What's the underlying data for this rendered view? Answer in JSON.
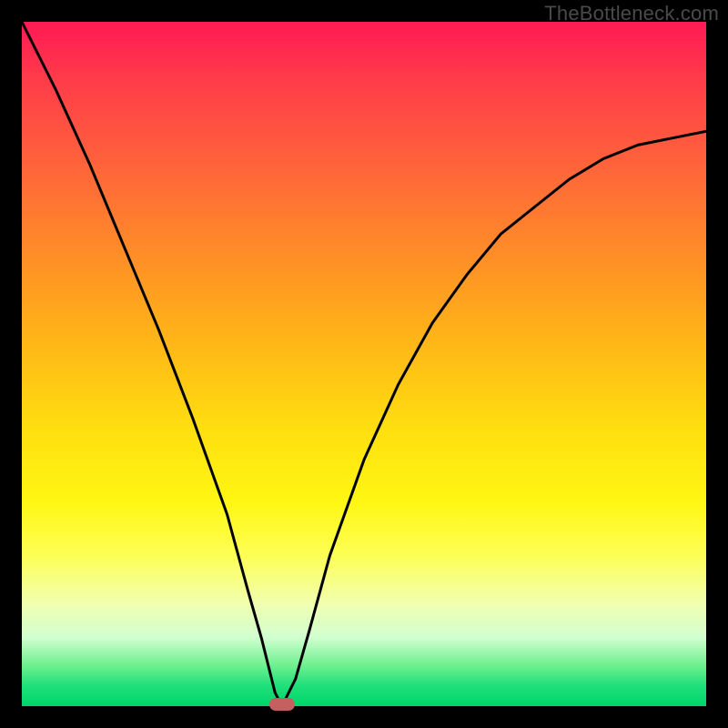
{
  "watermark": "TheBottleneck.com",
  "chart_data": {
    "type": "line",
    "title": "",
    "xlabel": "",
    "ylabel": "",
    "xlim": [
      0,
      100
    ],
    "ylim": [
      0,
      100
    ],
    "grid": false,
    "series": [
      {
        "name": "bottleneck-curve",
        "x": [
          0,
          5,
          10,
          15,
          20,
          25,
          30,
          33,
          35,
          36,
          37,
          38,
          40,
          42,
          45,
          50,
          55,
          60,
          65,
          70,
          75,
          80,
          85,
          90,
          95,
          100
        ],
        "values": [
          100,
          90,
          79,
          67,
          55,
          42,
          28,
          17,
          10,
          6,
          2,
          0,
          4,
          11,
          22,
          36,
          47,
          56,
          63,
          69,
          73,
          77,
          80,
          82,
          83,
          84
        ]
      }
    ],
    "annotations": [
      {
        "name": "optimal-marker",
        "x": 38,
        "y": 0
      }
    ],
    "background_gradient": {
      "top": "#ff1a54",
      "mid": "#ffe010",
      "bottom": "#00d56a"
    },
    "colors": {
      "curve": "#000000",
      "marker": "#c46060",
      "frame": "#000000"
    }
  }
}
